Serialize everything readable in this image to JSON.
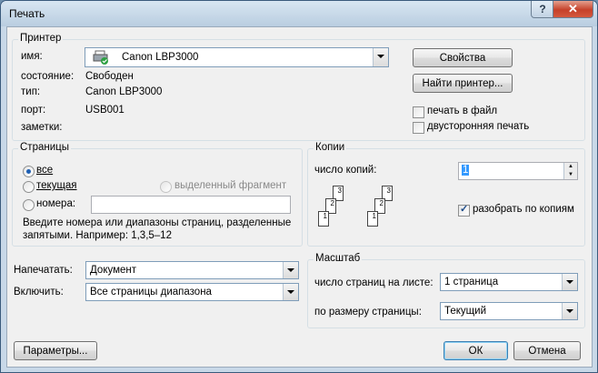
{
  "dialog": {
    "title": "Печать"
  },
  "printer": {
    "group_label": "Принтер",
    "name_label": "имя:",
    "name_value": "Canon LBP3000",
    "status_label": "состояние:",
    "status_value": "Свободен",
    "type_label": "тип:",
    "type_value": "Canon LBP3000",
    "port_label": "порт:",
    "port_value": "USB001",
    "notes_label": "заметки:",
    "properties_button": "Свойства",
    "find_button": "Найти принтер...",
    "print_to_file": "печать в файл",
    "duplex": "двусторонняя печать"
  },
  "pages": {
    "group_label": "Страницы",
    "all": "все",
    "current": "текущая",
    "selection": "выделенный фрагмент",
    "numbers": "номера:",
    "numbers_value": "",
    "hint_line1": "Введите номера или диапазоны страниц, разделенные",
    "hint_line2": "запятыми. Например: 1,3,5–12"
  },
  "copies": {
    "group_label": "Копии",
    "count_label": "число копий:",
    "count_value": "1",
    "collate": "разобрать по копиям",
    "collate_checked": true
  },
  "print_what": {
    "label": "Напечатать:",
    "value": "Документ"
  },
  "include": {
    "label": "Включить:",
    "value": "Все страницы диапазона"
  },
  "zoom": {
    "group_label": "Масштаб",
    "pages_per_sheet_label": "число страниц на листе:",
    "pages_per_sheet_value": "1 страница",
    "scale_label": "по размеру страницы:",
    "scale_value": "Текущий"
  },
  "buttons": {
    "options": "Параметры...",
    "ok": "ОК",
    "cancel": "Отмена"
  }
}
